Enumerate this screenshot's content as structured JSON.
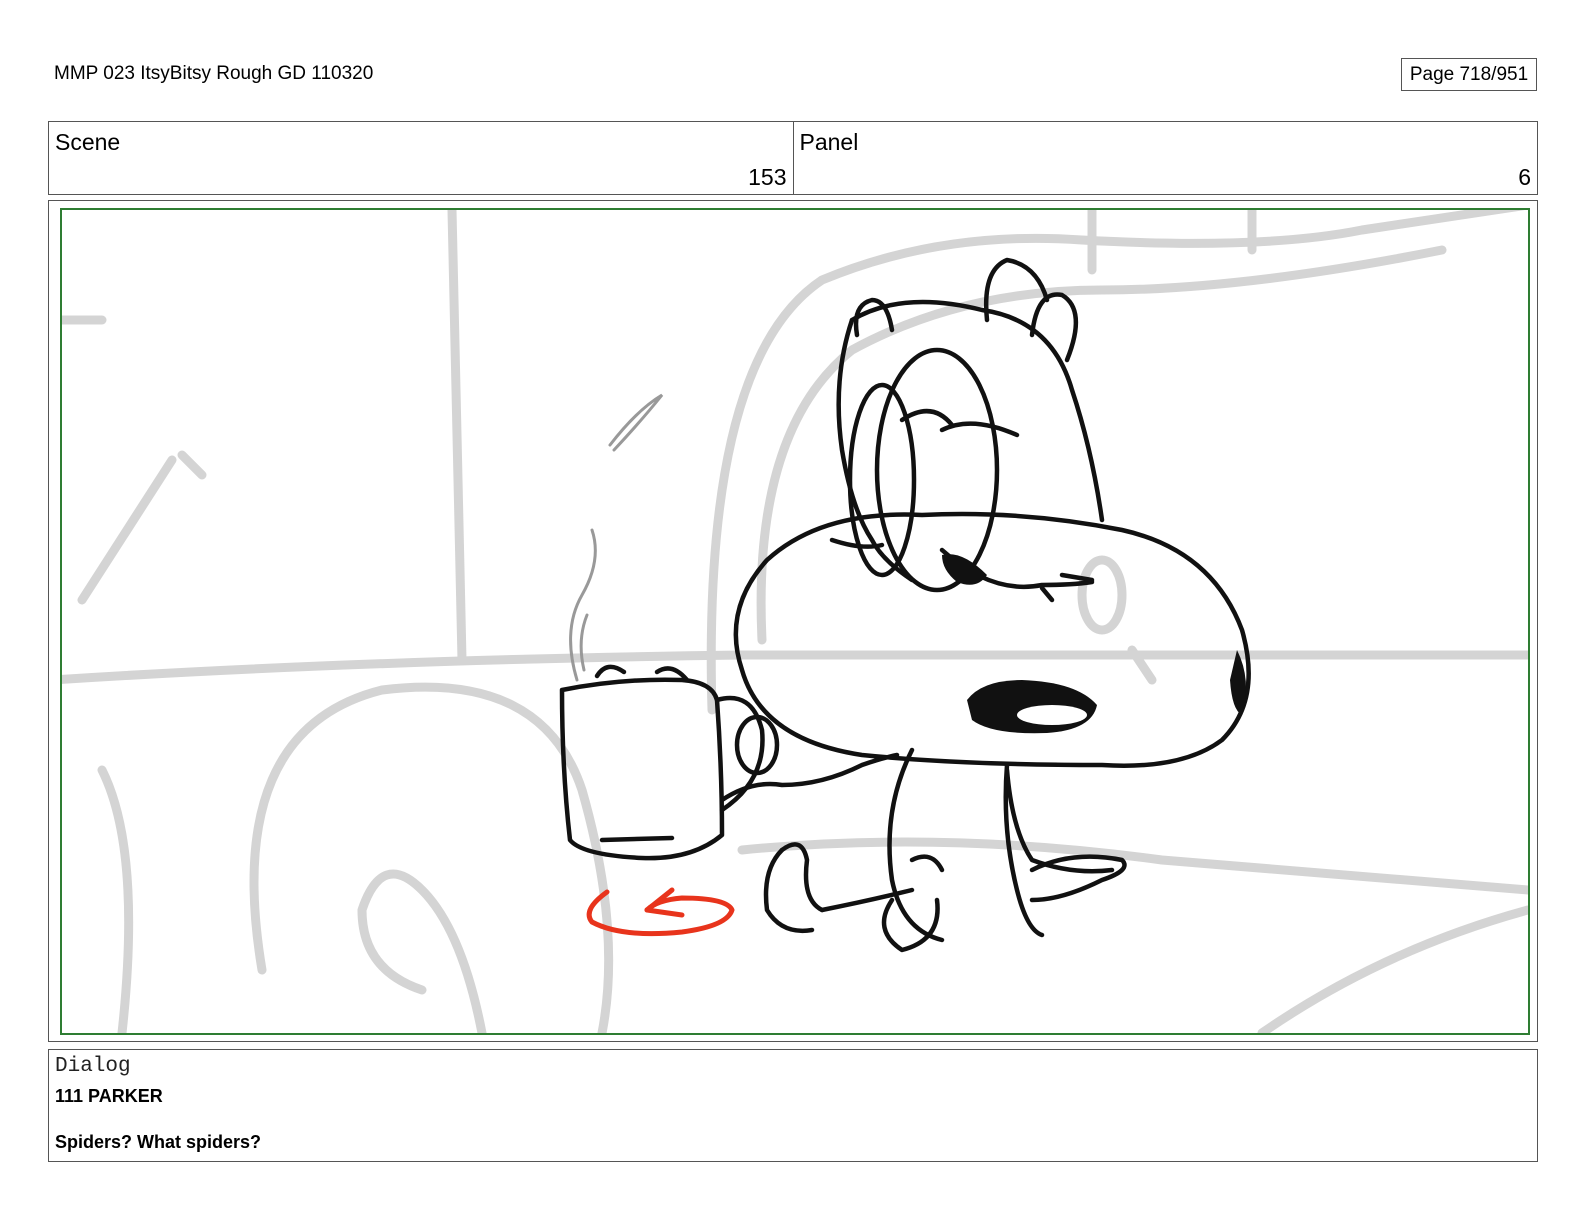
{
  "document": {
    "title": "MMP 023 ItsyBitsy Rough GD 110320",
    "page": "Page 718/951"
  },
  "header": {
    "scene_label": "Scene",
    "scene_value": "153",
    "panel_label": "Panel",
    "panel_value": "6"
  },
  "dialog": {
    "label": "Dialog",
    "speaker": "111 PARKER",
    "line": "Spiders? What spiders?"
  },
  "colors": {
    "frame_border": "#2e7d32",
    "background_sketch": "#d4d4d4",
    "character_ink": "#111111",
    "camera_move_arrow": "#e8341c"
  }
}
